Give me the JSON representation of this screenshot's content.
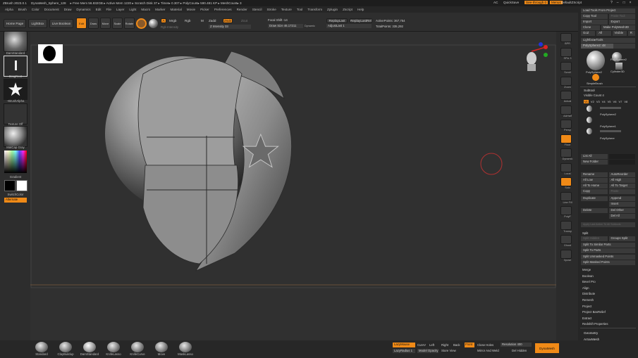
{
  "titlebar": {
    "app": "ZBrush 2023.0.1",
    "file": "DynaMesh_Sphere_128",
    "stats": "▸ Free Mem 56.832GB ▸ Active Mem 1220 ▸ Scratch Disk 37 ▸ Timer▸ 0.307 ▸ PolyCount▸ 590.481 KP ▸ MeshCount▸ 3",
    "ac": "AC",
    "quicksave": "QuickSave",
    "seethrough": "See-through 0",
    "menus": "Menus",
    "script": "DefaultZScript"
  },
  "menubar": [
    "Alpha",
    "Brush",
    "Color",
    "Document",
    "Draw",
    "Dynamics",
    "Edit",
    "File",
    "Layer",
    "Light",
    "Macro",
    "Marker",
    "Material",
    "Movie",
    "Picker",
    "Preferences",
    "Render",
    "Stencil",
    "Stroke",
    "Texture",
    "Tool",
    "Transform",
    "Zplugin",
    "Zscript",
    "Help"
  ],
  "toolbar": {
    "home": "Home Page",
    "lightbox": "LightBox",
    "live_boolean": "Live Boolean",
    "edit": "Edit",
    "draw": "Draw",
    "move": "Move",
    "scale": "Scale",
    "rotate": "Rotate",
    "a_label": "A",
    "mrgb": "Mrgb",
    "rgb": "Rgb",
    "m": "M",
    "zadd": "Zadd",
    "zsub": "Zsub",
    "zcut": "Zcut",
    "rgb_intensity": "Rgb Intensity",
    "z_intensity": "Z Intensity 33",
    "focal_shift": "Focal Shift -14",
    "draw_size": "Draw Size 46.17211",
    "dynamic": "Dynamic",
    "replay_last": "ReplayLast",
    "replay_last_rel": "ReplayLastRel",
    "adjust_last": "AdjustLast 1",
    "active_points": "ActivePoints: 367,754",
    "total_points": "TotalPoints: 335,292"
  },
  "leftpanel": {
    "dam_standard": "DamStandard",
    "dragrect": "DragRect",
    "brush_alpha": "~BrushAlpha",
    "texture_off": "Texture Off",
    "matcap": "MatCap Gray",
    "gradient": "Gradient",
    "switch_color": "SwitchColor",
    "alternate": "Alternate"
  },
  "rightstrip": [
    "BPR",
    "SPix 3",
    "Scroll",
    "Zoom",
    "Actual",
    "AAHalf",
    "Persp",
    "Floor",
    "Dynamic",
    "Local",
    "Solo",
    "Line Fill",
    "PolyF",
    "Transp",
    "Ghost",
    "Xpose"
  ],
  "rightpanel": {
    "load_tools": "Load Tools From Project",
    "copy_tool": "Copy Tool",
    "paste_tool": "Paste Tool",
    "import": "Import",
    "export": "Export",
    "clone": "Clone",
    "make_polymesh": "Make PolyMesh3D",
    "goz": "GoZ",
    "all": "All",
    "visible": "Visible",
    "r": "R",
    "lightbox_tools": "Lightbox▸Tools",
    "polysphere_slider": "PolySphere2: 48",
    "tools": [
      "PolySphere2",
      "PolySphere2",
      "Cylinder3D",
      "SimpleBrush"
    ],
    "subtool_header": "Subtool",
    "visible_count": "Visible Count 4",
    "versions": [
      "V1",
      "V2",
      "V3",
      "V4",
      "V5",
      "V6",
      "V7",
      "V8"
    ],
    "subtools": [
      "PolySphere2",
      "PolySphere1",
      "PolySphere"
    ],
    "list_all": "List All",
    "new_folder": "New Folder",
    "rename": "Rename",
    "auto_reorder": "AutoReorder",
    "all_low": "All Low",
    "all_high": "All High",
    "all_to_home": "All To Home",
    "all_to_target": "All To Target",
    "copy": "Copy",
    "paste": "Paste",
    "duplicate": "Duplicate",
    "append": "Append",
    "insert": "Insert",
    "delete": "Delete",
    "del_other": "Del Other",
    "del_all": "Del All",
    "apply_last": "Apply Last Action To All Subtools",
    "split_header": "Split",
    "split_hidden": "Split Hidden",
    "groups_split": "Groups Split",
    "split_similar": "Split To Similar Parts",
    "split_parts": "Split To Parts",
    "split_unmasked": "Split Unmasked Points",
    "split_masked": "Split Masked Points",
    "sections": [
      "Merge",
      "Boolean",
      "Bevel Pro",
      "Align",
      "Distribute",
      "Remesh",
      "Project",
      "Project BasRelief",
      "Extract",
      "Redshift Properties"
    ],
    "lower_sections": [
      "Geometry",
      "ArrayMesh",
      "NanoMesh",
      "Slime Bridge",
      "Thick Skin"
    ]
  },
  "bottombar": {
    "brushes": [
      "Standard",
      "ClayBuildup",
      "DamStandard",
      "KnifeLasso",
      "KnifeCurve",
      "Move",
      "MaskLasso"
    ],
    "lazymouse": "LazyMouse",
    "lazyradius": "LazyRadius 1",
    "curv": "CurvV",
    "left": "Left",
    "right": "Right",
    "back": "Back",
    "model_opacity": "Model Opacity",
    "store_view": "Store View",
    "front": "Front",
    "close_holes": "Close Holes",
    "resolution": "Resolution 400",
    "mirror_weld": "Mirror And Weld",
    "del_hidden": "Del Hidden",
    "dynamesh": "DynaMesh"
  },
  "colors": {
    "accent": "#f08a17",
    "panel": "#2d2d2d",
    "viewport": "#303030"
  }
}
